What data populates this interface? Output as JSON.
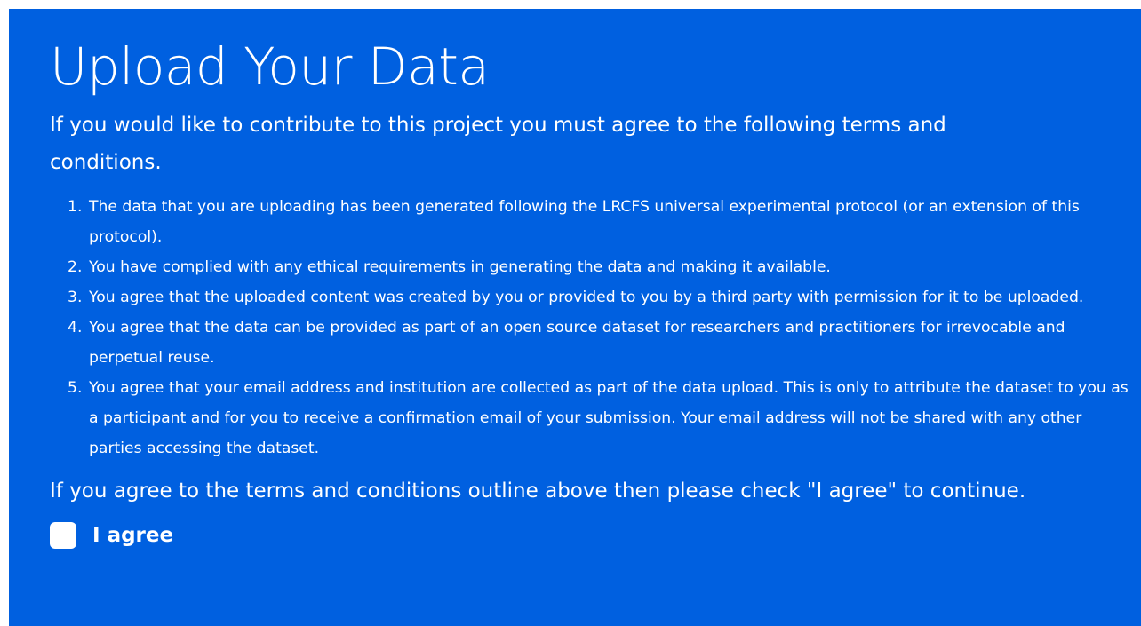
{
  "page": {
    "title": "Upload Your Data",
    "intro": "If you would like to contribute to this project you must agree to the following terms and conditions.",
    "terms": [
      "The data that you are uploading has been generated following the LRCFS universal experimental protocol (or an extension of this protocol).",
      "You have complied with any ethical requirements in generating the data and making it available.",
      "You agree that the uploaded content was created by you or provided to you by a third party with permission for it to be uploaded.",
      "You agree that the data can be provided as part of an open source dataset for researchers and practitioners for irrevocable and perpetual reuse.",
      "You agree that your email address and institution are collected as part of the data upload. This is only to attribute the dataset to you as a participant and for you to receive a confirmation email of your submission. Your email address will not be shared with any other parties accessing the dataset."
    ],
    "closing": "If you agree to the terms and conditions outline above then please check \"I agree\" to continue.",
    "agree_label": "I agree",
    "agree_checked": false
  },
  "colors": {
    "panel_background": "#0060e0",
    "text": "#ffffff"
  }
}
